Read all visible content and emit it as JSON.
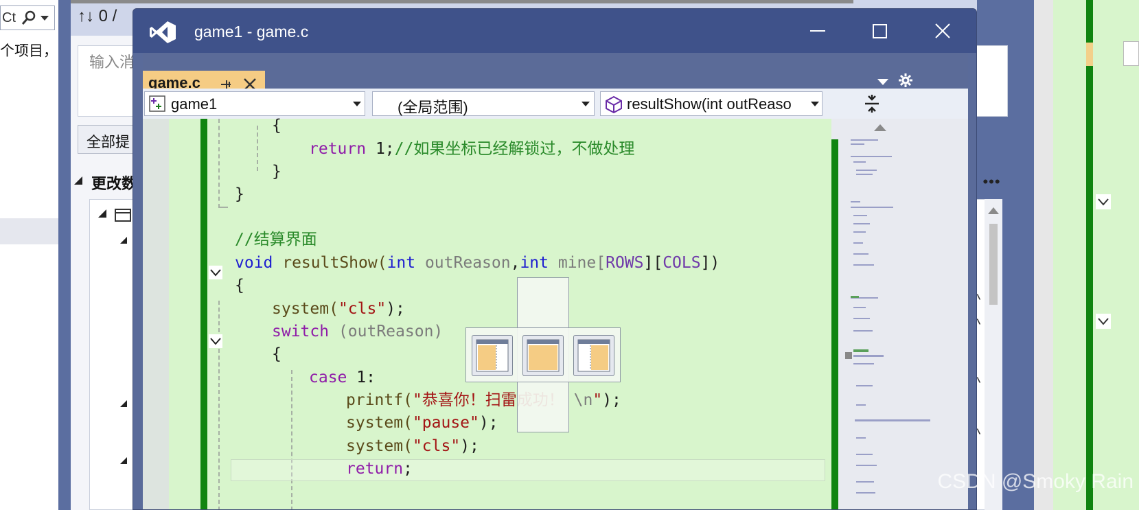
{
  "background": {
    "search_placeholder": "Ct",
    "sort_label": "↑↓ 0 /",
    "items_label": "个项目，",
    "input_placeholder": "输入消",
    "all_button": "全部提",
    "section_title": "更改数"
  },
  "window": {
    "title": "game1 - game.c",
    "tab_label": "game.c"
  },
  "navbar": {
    "project": "game1",
    "scope": "(全局范围)",
    "member": "resultShow(int outReaso"
  },
  "code": {
    "l1": "{",
    "l2_kw": "return",
    "l2_num": " 1",
    "l2_rest": ";",
    "l2_cm": "//如果坐标已经解锁过，不做处理",
    "l3": "}",
    "l4": "}",
    "l5_cm": "//结算界面",
    "l6_kw": "void",
    "l6_fn": " resultShow(",
    "l6_int1": "int",
    "l6_p1": " outReason",
    "l6_c": ",",
    "l6_int2": "int",
    "l6_p2": " mine[",
    "l6_rows": "ROWS",
    "l6_mid": "][",
    "l6_cols": "COLS",
    "l6_end": "])",
    "l7": "{",
    "l8_fn": "system(",
    "l8_str": "\"cls\"",
    "l8_end": ");",
    "l9_kw": "switch",
    "l9_rest": " (outReason)",
    "l10": "{",
    "l11_kw": "case",
    "l11_rest": " 1:",
    "l12_fn": "printf(",
    "l12_str": "\"恭喜你！扫雷成功！",
    "l12_esc": " \\n",
    "l12_q": "\"",
    "l12_end": ");",
    "l13_fn": "system(",
    "l13_str": "\"pause\"",
    "l13_end": ");",
    "l14_fn": "system(",
    "l14_str": "\"cls\"",
    "l14_end": ");",
    "l15_kw": "return",
    "l15_end": ";"
  },
  "watermark": "CSDN @Smoky Rain",
  "colors": {
    "editor_bg": "#d8f5cc",
    "change_bar": "#108410",
    "tab_active": "#f5cc84",
    "title_bar": "#3f528a"
  }
}
